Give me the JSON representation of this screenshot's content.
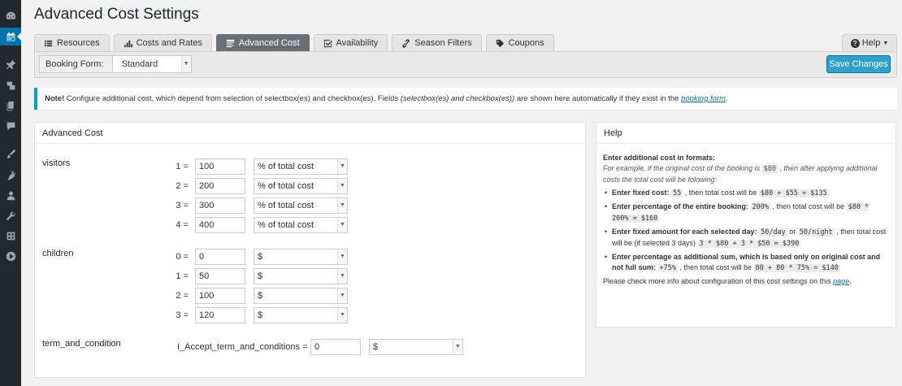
{
  "sidebar": {
    "icons": [
      "dashboard-icon",
      "calendar-icon",
      "pin-icon",
      "media-icon",
      "pages-icon",
      "comments-icon",
      "appearance-icon",
      "plugins-icon",
      "users-icon",
      "tools-icon",
      "settings-icon",
      "play-icon"
    ],
    "active_index": 1
  },
  "page_title": "Advanced Cost Settings",
  "tabs": [
    {
      "label": "Resources",
      "icon": "list-icon",
      "active": false
    },
    {
      "label": "Costs and Rates",
      "icon": "bar-chart-icon",
      "active": false
    },
    {
      "label": "Advanced Cost",
      "icon": "advanced-icon",
      "active": true
    },
    {
      "label": "Availability",
      "icon": "check-square-icon",
      "active": false
    },
    {
      "label": "Season Filters",
      "icon": "link-icon",
      "active": false
    },
    {
      "label": "Coupons",
      "icon": "tag-icon",
      "active": false
    }
  ],
  "help_tab": {
    "label": "Help"
  },
  "toolbar": {
    "form_label": "Booking Form:",
    "form_value": "Standard",
    "save_label": "Save Changes"
  },
  "notice": {
    "strong": "Note!",
    "text1": " Configure additional cost, which depend from selection of selectbox(es) and checkbox(es). Fields ",
    "italic": "(selectbox(es) and checkbox(es))",
    "text2": " are shown here automatically if they exist in the ",
    "link": "booking form",
    "text3": "."
  },
  "advanced_cost": {
    "title": "Advanced Cost",
    "fields": [
      {
        "name": "visitors",
        "rows": [
          {
            "label": "1 =",
            "value": "100",
            "type": "% of total cost"
          },
          {
            "label": "2 =",
            "value": "200",
            "type": "% of total cost"
          },
          {
            "label": "3 =",
            "value": "300",
            "type": "% of total cost"
          },
          {
            "label": "4 =",
            "value": "400",
            "type": "% of total cost"
          }
        ]
      },
      {
        "name": "children",
        "rows": [
          {
            "label": "0 =",
            "value": "0",
            "type": "$"
          },
          {
            "label": "1 =",
            "value": "50",
            "type": "$"
          },
          {
            "label": "2 =",
            "value": "100",
            "type": "$"
          },
          {
            "label": "3 =",
            "value": "120",
            "type": "$"
          }
        ]
      },
      {
        "name": "term_and_condition",
        "rows": [
          {
            "label": "I_Accept_term_and_conditions =",
            "value": "0",
            "type": "$"
          }
        ]
      }
    ]
  },
  "help": {
    "title": "Help",
    "lead": "Enter additional cost in formats:",
    "ex1": "For example, if the original cost of the booking is ",
    "ex_code": "$80",
    "ex2": " , then after applying additional costs the total cost will be folowing:",
    "items": [
      {
        "b": "Enter fixed cost:",
        "c1": "55",
        "t1": " , then total cost will be ",
        "c2": "$80 + $55 = $135",
        "t2": "",
        "c3": "",
        "t3": "",
        "c4": ""
      },
      {
        "b": "Enter percentage of the entire booking:",
        "c1": "200%",
        "t1": " , then total cost will be ",
        "c2": "$80 * 200% = $160",
        "t2": "",
        "c3": "",
        "t3": "",
        "c4": ""
      },
      {
        "b": "Enter fixed amount for each selected day:",
        "c1": "50/day",
        "t1": " or ",
        "c2": "50/night",
        "t2": " , then total cost will be (if selected 3 days) ",
        "c3": "3 * $80 + 3 * $50 = $390",
        "t3": "",
        "c4": ""
      },
      {
        "b": "Enter percentage as additional sum, which is based only on original cost and not full sum:",
        "c1": "+75%",
        "t1": " , then total cost will be ",
        "c2": "80 + 80 * 75% = $140",
        "t2": "",
        "c3": "",
        "t3": "",
        "c4": ""
      }
    ],
    "footer_text": "Please check more info about configuration of this cost settings on this ",
    "footer_link": "page",
    "footer_end": "."
  }
}
